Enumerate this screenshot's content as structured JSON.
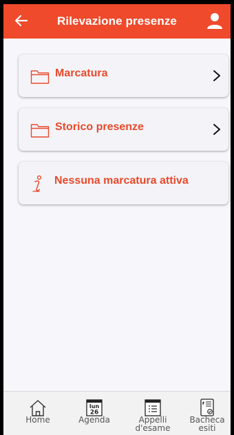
{
  "header": {
    "title": "Rilevazione presenze",
    "back_icon": "arrow-left-icon",
    "user_icon": "user-icon",
    "bg_color": "#ee4a2b"
  },
  "menu": {
    "items": [
      {
        "label": "Marcatura",
        "icon": "folder-icon",
        "has_chevron": true
      },
      {
        "label": "Storico presenze",
        "icon": "folder-icon",
        "has_chevron": true
      },
      {
        "label": "Nessuna marcatura attiva",
        "icon": "info-icon",
        "has_chevron": false
      }
    ],
    "accent_color": "#e8492c"
  },
  "bottom_nav": {
    "items": [
      {
        "label": "Home",
        "icon": "home-icon"
      },
      {
        "label": "Agenda",
        "icon": "calendar-icon",
        "day_name": "lun",
        "day_number": "26"
      },
      {
        "label_line1": "Appelli",
        "label_line2": "d'esame",
        "icon": "exam-calendar-icon"
      },
      {
        "label_line1": "Bacheca",
        "label_line2": "esiti",
        "icon": "results-board-icon"
      }
    ]
  }
}
